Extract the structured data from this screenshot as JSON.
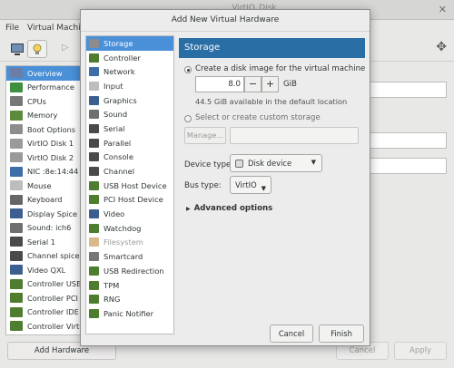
{
  "background_window": {
    "title": "VirtIO_Disk",
    "menu": [
      "File",
      "Virtual Machine"
    ],
    "hardware_list": [
      {
        "label": "Overview",
        "icon": "overview-icon",
        "color": "#6a7ea8",
        "selected": true
      },
      {
        "label": "Performance",
        "icon": "performance-icon",
        "color": "#3e8f3e"
      },
      {
        "label": "CPUs",
        "icon": "cpu-icon",
        "color": "#777777"
      },
      {
        "label": "Memory",
        "icon": "memory-icon",
        "color": "#5b8a3a"
      },
      {
        "label": "Boot Options",
        "icon": "boot-options-icon",
        "color": "#8d8d8d"
      },
      {
        "label": "VirtIO Disk 1",
        "icon": "disk-icon",
        "color": "#9a9a9a"
      },
      {
        "label": "VirtIO Disk 2",
        "icon": "disk-icon",
        "color": "#9a9a9a"
      },
      {
        "label": "NIC :8e:14:44",
        "icon": "nic-icon",
        "color": "#3d6ea8"
      },
      {
        "label": "Mouse",
        "icon": "mouse-icon",
        "color": "#bdbdbd"
      },
      {
        "label": "Keyboard",
        "icon": "keyboard-icon",
        "color": "#666666"
      },
      {
        "label": "Display Spice",
        "icon": "display-icon",
        "color": "#3c5f8f"
      },
      {
        "label": "Sound: ich6",
        "icon": "sound-icon",
        "color": "#6f6f6f"
      },
      {
        "label": "Serial 1",
        "icon": "serial-icon",
        "color": "#4a4a4a"
      },
      {
        "label": "Channel spice",
        "icon": "channel-icon",
        "color": "#4a4a4a"
      },
      {
        "label": "Video QXL",
        "icon": "video-icon",
        "color": "#3c5f8f"
      },
      {
        "label": "Controller USB",
        "icon": "controller-icon",
        "color": "#4f7d2f"
      },
      {
        "label": "Controller PCI",
        "icon": "controller-icon",
        "color": "#4f7d2f"
      },
      {
        "label": "Controller IDE",
        "icon": "controller-icon",
        "color": "#4f7d2f"
      },
      {
        "label": "Controller VirtIO",
        "icon": "controller-icon",
        "color": "#4f7d2f"
      }
    ],
    "add_hardware_label": "Add Hardware",
    "cancel_label": "Cancel",
    "apply_label": "Apply"
  },
  "dialog": {
    "title": "Add New Virtual Hardware",
    "types": [
      {
        "label": "Storage",
        "icon": "storage-icon",
        "color": "#8c8c8c",
        "selected": true
      },
      {
        "label": "Controller",
        "icon": "controller-icon",
        "color": "#4f7d2f"
      },
      {
        "label": "Network",
        "icon": "network-icon",
        "color": "#3d6ea8"
      },
      {
        "label": "Input",
        "icon": "input-icon",
        "color": "#bdbdbd"
      },
      {
        "label": "Graphics",
        "icon": "graphics-icon",
        "color": "#3c5f8f"
      },
      {
        "label": "Sound",
        "icon": "sound-icon",
        "color": "#6f6f6f"
      },
      {
        "label": "Serial",
        "icon": "serial-icon",
        "color": "#4a4a4a"
      },
      {
        "label": "Parallel",
        "icon": "parallel-icon",
        "color": "#4a4a4a"
      },
      {
        "label": "Console",
        "icon": "console-icon",
        "color": "#4a4a4a"
      },
      {
        "label": "Channel",
        "icon": "channel-icon",
        "color": "#4a4a4a"
      },
      {
        "label": "USB Host Device",
        "icon": "usb-icon",
        "color": "#4f7d2f"
      },
      {
        "label": "PCI Host Device",
        "icon": "pci-icon",
        "color": "#4f7d2f"
      },
      {
        "label": "Video",
        "icon": "video-icon",
        "color": "#3c5f8f"
      },
      {
        "label": "Watchdog",
        "icon": "watchdog-icon",
        "color": "#4f7d2f"
      },
      {
        "label": "Filesystem",
        "icon": "folder-icon",
        "color": "#d9b98c",
        "disabled": true
      },
      {
        "label": "Smartcard",
        "icon": "smartcard-icon",
        "color": "#777777"
      },
      {
        "label": "USB Redirection",
        "icon": "usb-redir-icon",
        "color": "#4f7d2f"
      },
      {
        "label": "TPM",
        "icon": "tpm-icon",
        "color": "#4f7d2f"
      },
      {
        "label": "RNG",
        "icon": "rng-icon",
        "color": "#4f7d2f"
      },
      {
        "label": "Panic Notifier",
        "icon": "panic-notifier-icon",
        "color": "#4f7d2f"
      }
    ],
    "pane_header": "Storage",
    "create_disk_label": "Create a disk image for the virtual machine",
    "size_value": "8.0",
    "size_unit": "GiB",
    "minus_label": "−",
    "plus_label": "+",
    "available_text": "44.5 GiB available in the default location",
    "custom_storage_label": "Select or create custom storage",
    "manage_label": "Manage...",
    "device_type_label": "Device type:",
    "device_type_value": "Disk device",
    "bus_type_label": "Bus type:",
    "bus_type_value": "VirtIO",
    "advanced_label": "Advanced options",
    "cancel_label": "Cancel",
    "finish_label": "Finish"
  },
  "colors": {
    "selection": "#4a90d9",
    "pane_header": "#2a6ea6"
  }
}
